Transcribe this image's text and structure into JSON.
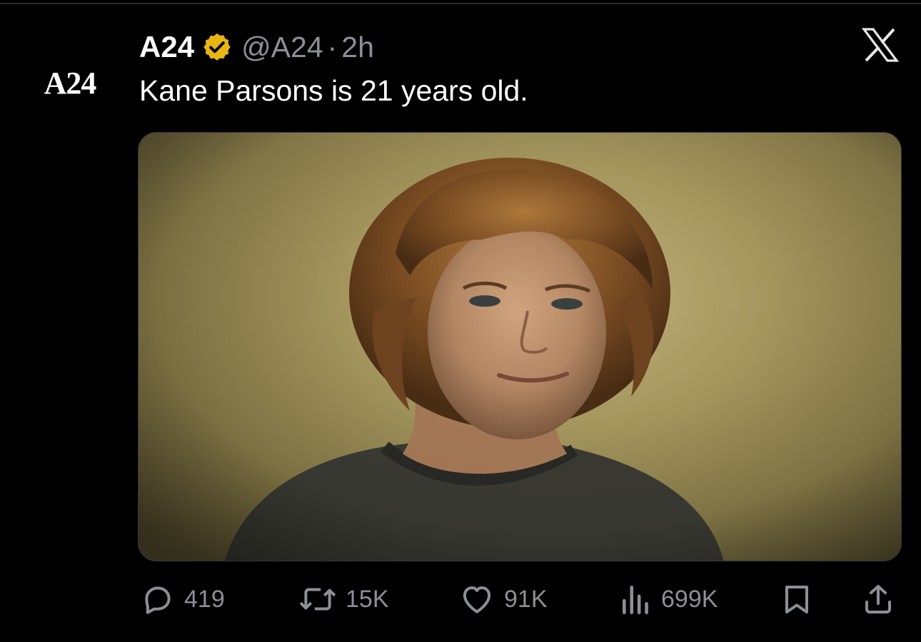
{
  "tweet": {
    "avatar_text": "A24",
    "display_name": "A24",
    "handle": "@A24",
    "separator": "·",
    "timestamp": "2h",
    "text": "Kane Parsons is 21 years old.",
    "verified_badge_color": "#e8b613",
    "media_description_icon": "photo-portrait"
  },
  "actions": {
    "replies": "419",
    "reposts": "15K",
    "likes": "91K",
    "views": "699K"
  },
  "icons": {
    "close": "x-logo-icon",
    "reply": "reply-bubble-icon",
    "repost": "repost-arrows-icon",
    "like": "heart-icon",
    "views": "bar-chart-icon",
    "bookmark": "bookmark-icon",
    "share": "share-upload-icon"
  },
  "colors": {
    "background": "#000000",
    "text_primary": "#ffffff",
    "text_secondary": "#8b9095"
  }
}
